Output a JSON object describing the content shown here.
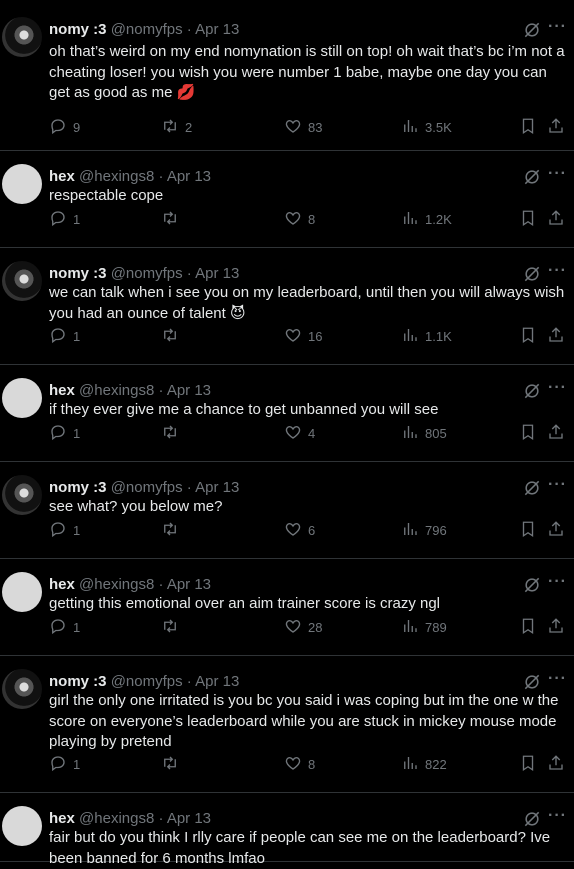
{
  "tweets": [
    {
      "name": "nomy :3",
      "handle": "@nomyfps",
      "date": "Apr 13",
      "text": "oh that’s weird on my end nomynation is still on top! oh wait that’s bc i’m not a cheating loser! you wish you were number 1 babe, maybe one day you can get as good as me 💋",
      "replies": "9",
      "retweets": "2",
      "likes": "83",
      "views": "3.5K",
      "avatar": "nomy"
    },
    {
      "name": "hex",
      "handle": "@hexings8",
      "date": "Apr 13",
      "text": "respectable cope",
      "replies": "1",
      "retweets": "",
      "likes": "8",
      "views": "1.2K",
      "avatar": "hex"
    },
    {
      "name": "nomy :3",
      "handle": "@nomyfps",
      "date": "Apr 13",
      "text": "we can talk when i see you on my leaderboard, until then you will always wish you had an ounce of talent 😈",
      "replies": "1",
      "retweets": "",
      "likes": "16",
      "views": "1.1K",
      "avatar": "nomy"
    },
    {
      "name": "hex",
      "handle": "@hexings8",
      "date": "Apr 13",
      "text": "if they ever give me a chance to get unbanned you will see",
      "replies": "1",
      "retweets": "",
      "likes": "4",
      "views": "805",
      "avatar": "hex"
    },
    {
      "name": "nomy :3",
      "handle": "@nomyfps",
      "date": "Apr 13",
      "text": "see what? you below me?",
      "replies": "1",
      "retweets": "",
      "likes": "6",
      "views": "796",
      "avatar": "nomy"
    },
    {
      "name": "hex",
      "handle": "@hexings8",
      "date": "Apr 13",
      "text": "getting this emotional over an aim trainer score is crazy ngl",
      "replies": "1",
      "retweets": "",
      "likes": "28",
      "views": "789",
      "avatar": "hex"
    },
    {
      "name": "nomy :3",
      "handle": "@nomyfps",
      "date": "Apr 13",
      "text": "girl the only one irritated is you bc you said i was coping but im the one w the score on everyone’s leaderboard while you are stuck in mickey mouse mode playing by pretend",
      "replies": "1",
      "retweets": "",
      "likes": "8",
      "views": "822",
      "avatar": "nomy"
    },
    {
      "name": "hex",
      "handle": "@hexings8",
      "date": "Apr 13",
      "text": "fair but do you think I rlly care if people can see me on the leaderboard? Ive been banned for 6 months lmfao",
      "replies": "",
      "retweets": "",
      "likes": "",
      "views": "",
      "avatar": "hex"
    }
  ],
  "separator": " · ",
  "more_label": "···"
}
